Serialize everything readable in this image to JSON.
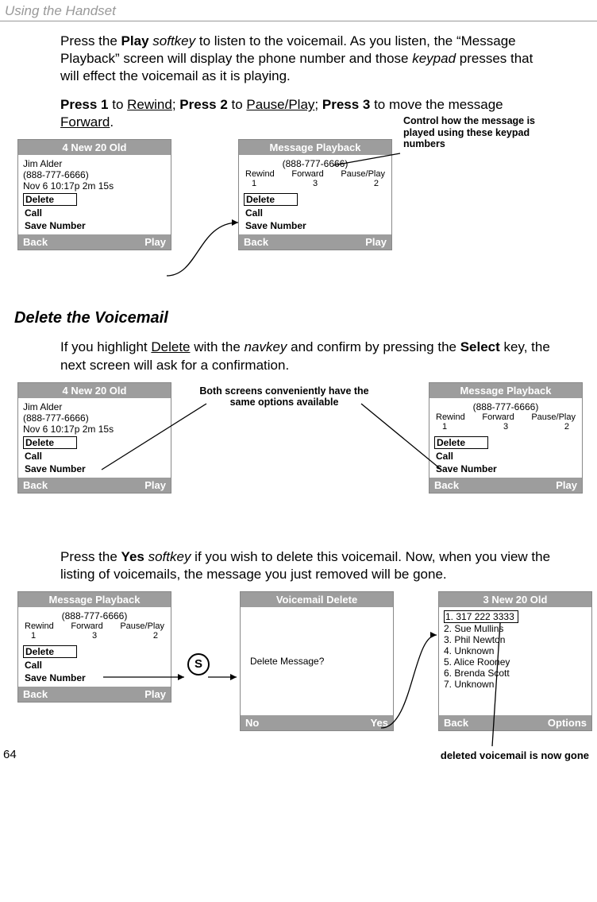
{
  "header": "Using the Handset",
  "para1_pre": "Press the ",
  "para1_play": "Play",
  "para1_mid1": " ",
  "para1_softkey": "softkey",
  "para1_mid2": " to listen to the voicemail. As you listen, the “Message Playback” screen will display the phone number and those ",
  "para1_keypad": "keypad",
  "para1_end": " presses that will effect the voicemail as it is playing.",
  "para2_a": "Press 1",
  "para2_b": " to ",
  "para2_rewind": "Rewind",
  "para2_c": "; ",
  "para2_d": "Press 2",
  "para2_e": " to ",
  "para2_pause": "Pause/Play",
  "para2_f": "; ",
  "para2_g": "Press 3",
  "para2_h": " to move the message ",
  "para2_forward": "Forward",
  "para2_i": ".",
  "annot_top": "Control how the message is played using these keypad numbers",
  "phoneA": {
    "title": "4 New 20 Old",
    "name": "Jim Alder",
    "num": "(888-777-6666)",
    "meta": "Nov 6   10:17p  2m 15s",
    "opt1": "Delete",
    "opt2": "Call",
    "opt3": "Save Number",
    "skL": "Back",
    "skR": "Play"
  },
  "phoneB": {
    "title": "Message Playback",
    "num": "(888-777-6666)",
    "c1": "Rewind",
    "c2": "Forward",
    "c3": "Pause/Play",
    "k1": "1",
    "k2": "3",
    "k3": "2",
    "opt1": "Delete",
    "opt2": "Call",
    "opt3": "Save Number",
    "skL": "Back",
    "skR": "Play"
  },
  "section2": "Delete the Voicemail",
  "para3_a": "If you highlight ",
  "para3_delete": "Delete",
  "para3_b": " with the ",
  "para3_navkey": "navkey",
  "para3_c": " and confirm by pressing the ",
  "para3_select": "Select",
  "para3_d": " key, the next screen will ask for a confirmation.",
  "annot_mid": "Both screens conveniently have the same options available",
  "para4_a": "Press the ",
  "para4_yes": "Yes",
  "para4_b": " ",
  "para4_softkey": "softkey",
  "para4_c": " if you wish to delete this voicemail. Now, when you view the listing of voicemails, the message you just removed will be gone.",
  "phoneDelConfirm": {
    "title": "Voicemail Delete",
    "msg": "Delete Message?",
    "skL": "No",
    "skR": "Yes"
  },
  "phoneList": {
    "title": "3 New 20 Old",
    "rows": [
      "1. 317 222 3333",
      "2. Sue Mullins",
      "3. Phil Newton",
      "4. Unknown",
      "5. Alice Rooney",
      "6. Brenda Scott",
      "7. Unknown"
    ],
    "skL": "Back",
    "skR": "Options"
  },
  "annot_bottom": "deleted voicemail is now gone",
  "page_num": "64",
  "s_letter": "S"
}
